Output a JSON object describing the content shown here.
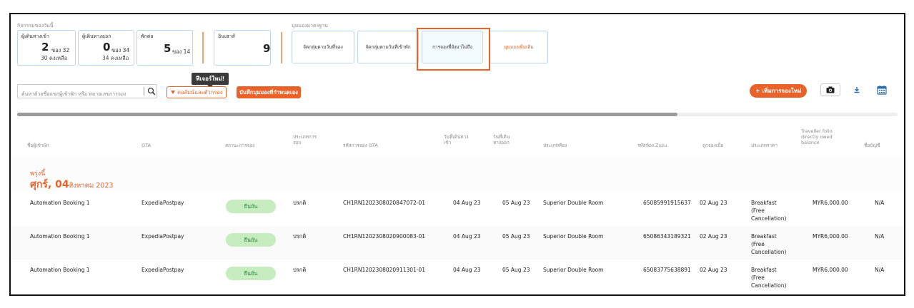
{
  "activity": {
    "section_label": "กิจกรรมของวันนี้",
    "arrivals": {
      "title": "ผู้เดินทางเข้า",
      "count": "2",
      "of_text": "ของ 32",
      "remaining_text": "30 คงเหลือ"
    },
    "departures": {
      "title": "ผู้เดินทางออก",
      "count": "0",
      "of_text": "ของ 34",
      "remaining_text": "34 คงเหลือ"
    },
    "stays": {
      "title": "พักต่อ",
      "count": "5",
      "of_text": "ของ 14"
    },
    "week": {
      "title": "อินเฮาส์",
      "count": "9"
    }
  },
  "standard_views": {
    "section_label": "มุมมองมาตรฐาน",
    "items": [
      {
        "label": "จัดกลุ่มตามวันที่จอง"
      },
      {
        "label": "จัดกลุ่มตามวันที่เข้าพัก"
      },
      {
        "label": "การจองที่ยังมาไม่ถึง"
      },
      {
        "label": "มุมมองเพิ่มเติม"
      }
    ]
  },
  "toolbar": {
    "search_placeholder": "ค้นหาด้วยชื่อแขกผู้เข้าพัก หรือ หมายเลขการจอง",
    "tooltip": "ฟีเจอร์ใหม่!",
    "filter_label": "คอลัมน์และตัวกรอง",
    "save_view_label": "บันทึกมุมมองที่กำหนดเอง",
    "new_booking_label": "+ เพิ่มการจองใหม่"
  },
  "scroll": {
    "thumb_fraction": 0.75
  },
  "table": {
    "headers": {
      "guest": "ชื่อผู้เข้าพัก",
      "ota": "OTA",
      "status": "สถานะการจอง",
      "booking_type": "ประเภทการ จอง",
      "ota_ref": "รหัสการจอง OTA",
      "checkin": "วันที่เดินทาง เข้า",
      "checkout": "วันที่เดิน ทางออก",
      "room_type": "ประเภทห้อง",
      "zuzu_code": "รหัสห้อง Zuzu",
      "booked_on": "ถูกจองเมื่อ",
      "rate_type": "ประเภทราคา",
      "traveller_folio": "Traveller folio directly owed balance",
      "account": "ชื่อบัญชี"
    },
    "date_group": {
      "subtitle": "พรุ่งนี้",
      "title": "ศุกร์, 04",
      "month_year": "สิงหาคม 2023"
    },
    "rows": [
      {
        "guest": "Automation Booking 1",
        "ota": "ExpediaPostpay",
        "status": "ยืนยัน",
        "booking_type": "ปรกติ",
        "ota_ref": "CH1RN1202308020847072-01",
        "checkin": "04 Aug 23",
        "checkout": "05 Aug 23",
        "room_type": "Superior Double Room",
        "zuzu_code": "65085991915637",
        "booked_on": "02 Aug 23",
        "rate_line1": "Breakfast",
        "rate_line2": "(Free",
        "rate_line3": "Cancellation)",
        "balance": "MYR6,000.00",
        "account": "N/A"
      },
      {
        "guest": "Automation Booking 1",
        "ota": "ExpediaPostpay",
        "status": "ยืนยัน",
        "booking_type": "ปรกติ",
        "ota_ref": "CH1RN1202308020900083-01",
        "checkin": "04 Aug 23",
        "checkout": "05 Aug 23",
        "room_type": "Superior Double Room",
        "zuzu_code": "65086343189321",
        "booked_on": "02 Aug 23",
        "rate_line1": "Breakfast",
        "rate_line2": "(Free",
        "rate_line3": "Cancellation)",
        "balance": "MYR6,000.00",
        "account": "N/A"
      },
      {
        "guest": "Automation Booking 1",
        "ota": "ExpediaPostpay",
        "status": "ยืนยัน",
        "booking_type": "ปรกติ",
        "ota_ref": "CH1RN1202308020911301-01",
        "checkin": "04 Aug 23",
        "checkout": "05 Aug 23",
        "room_type": "Superior Double Room",
        "zuzu_code": "65083775638891",
        "booked_on": "02 Aug 23",
        "rate_line1": "Breakfast",
        "rate_line2": "(Free",
        "rate_line3": "Cancellation)",
        "balance": "MYR6,000.00",
        "account": "N/A"
      }
    ]
  },
  "colors": {
    "accent": "#e8622a",
    "card_border": "#b9d6ee",
    "status_green_bg": "#c6ecc0",
    "status_green_text": "#2e8b3d",
    "calendar_blue": "#2b6cb0"
  }
}
